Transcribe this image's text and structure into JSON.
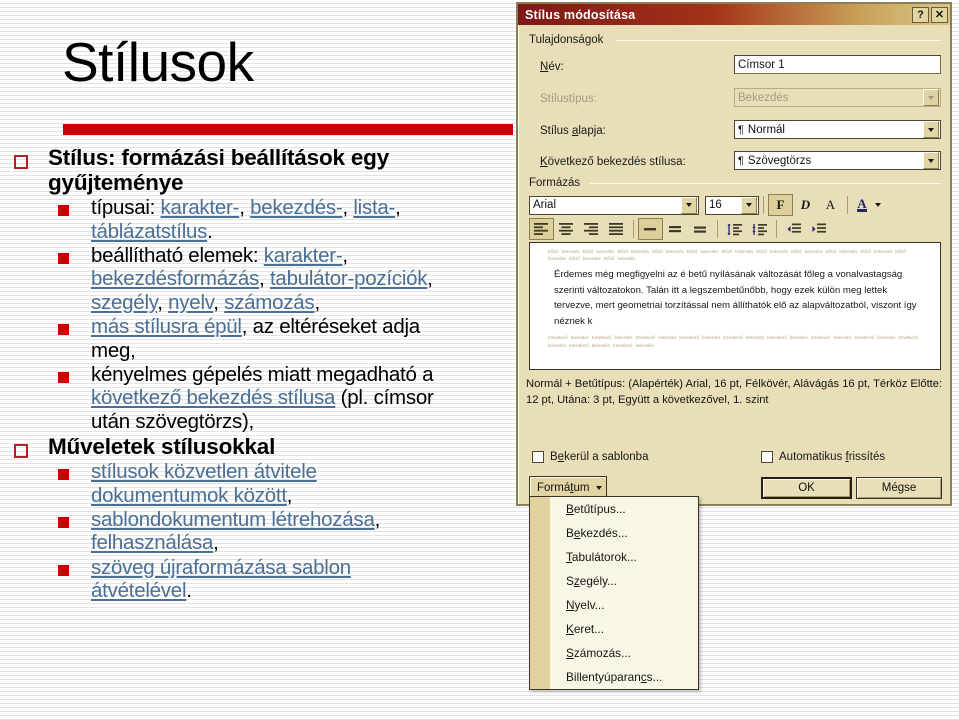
{
  "slide": {
    "title": "Stílusok",
    "accent_color": "#CC0000",
    "link_color": "#4A6F96",
    "bullets": [
      {
        "level": 1,
        "text": "Stílus: formázási beállítások egy gyűjteménye",
        "children": [
          {
            "level": 2,
            "html": "típusai: <span class=\"lk\">karakter-</span>, <span class=\"lk\">bekezdés-</span>, <span class=\"lk\">lista-</span>, <span class=\"lk\">táblázatstílus</span>."
          },
          {
            "level": 2,
            "html": "beállítható elemek: <span class=\"lk\">karakter-</span>, <span class=\"lk\">bekezdésformázás</span>, <span class=\"lk\">tabulátor-pozíciók</span>, <span class=\"lk\">szegély</span>, <span class=\"lk\">nyelv</span>, <span class=\"lk\">számozás</span>,"
          },
          {
            "level": 2,
            "html": "<span class=\"lk\">más stílusra épül</span>, az eltéréseket adja meg,"
          },
          {
            "level": 2,
            "html": "kényelmes gépelés miatt megadható a <span class=\"lk\">következő bekezdés stílusa</span> (pl. címsor után szövegtörzs),"
          }
        ]
      },
      {
        "level": 1,
        "text": "Műveletek stílusokkal",
        "children": [
          {
            "level": 2,
            "html": "<span class=\"lk\">stílusok közvetlen átvitele dokumentumok között</span>,"
          },
          {
            "level": 2,
            "html": "<span class=\"lk\">sablondokumentum létrehozása</span>, <span class=\"lk\">felhasználása</span>,"
          },
          {
            "level": 2,
            "html": "<span class=\"lk\">szöveg újraformázása sablon átvételével</span>."
          }
        ]
      }
    ]
  },
  "dialog": {
    "title": "Stílus módosítása",
    "help_button": "?",
    "close_button": "✕",
    "groups": {
      "properties_label": "Tulajdonságok",
      "formatting_label": "Formázás"
    },
    "fields": {
      "name_label": "Név:",
      "name_value": "Címsor 1",
      "styletype_label": "Stílustípus:",
      "styletype_value": "Bekezdés",
      "basedon_label": "Stílus alapja:",
      "basedon_value": "Normál",
      "nextstyle_label": "Következő bekezdés stílusa:",
      "nextstyle_value": "Szövegtörzs"
    },
    "toolbar": {
      "font_value": "Arial",
      "size_value": "16",
      "bold_glyph": "F",
      "italic_glyph": "D",
      "underline_glyph": "A",
      "fontcolor_glyph": "A"
    },
    "preview": {
      "faint_top": "Előző bekezdés Előző bekezdés Előző bekezdés Előző bekezdés Előző bekezdés Előző bekezdés Előző bekezdés Előző bekezdés Előző bekezdés Előző bekezdés Előző bekezdés Előző bekezdés Előző bekezdés",
      "main_text": "Érdemes még megfigyelni az é betű nyílásának változását főleg a vonalvastagság szerinti változatokon. Talán itt a legszembetűnőbb, hogy ezek külön meg lettek tervezve, mert geometriai torzítással nem állíthatók elő az alapváltozatból, viszont így néznek k",
      "faint_bottom": "Következő bekezdés Következő bekezdés Következő bekezdés Következő bekezdés Következő bekezdés Következő bekezdés Következő bekezdés Következő bekezdés Következő bekezdés Következő bekezdés Következő bekezdés"
    },
    "description": "Normál + Betűtípus: (Alapérték) Arial, 16 pt, Félkövér, Alávágás 16 pt, Térköz Előtte:  12 pt, Utána:  3 pt, Együtt a következővel, 1. szint",
    "checkboxes": {
      "add_to_template": "Bekerül a sablonba",
      "auto_update": "Automatikus frissítés"
    },
    "buttons": {
      "format": "Formátum",
      "ok": "OK",
      "cancel": "Mégse"
    },
    "format_menu": [
      "Betűtípus...",
      "Bekezdés...",
      "Tabulátorok...",
      "Szegély...",
      "Nyelv...",
      "Keret...",
      "Számozás...",
      "Billentyúparancs..."
    ]
  }
}
